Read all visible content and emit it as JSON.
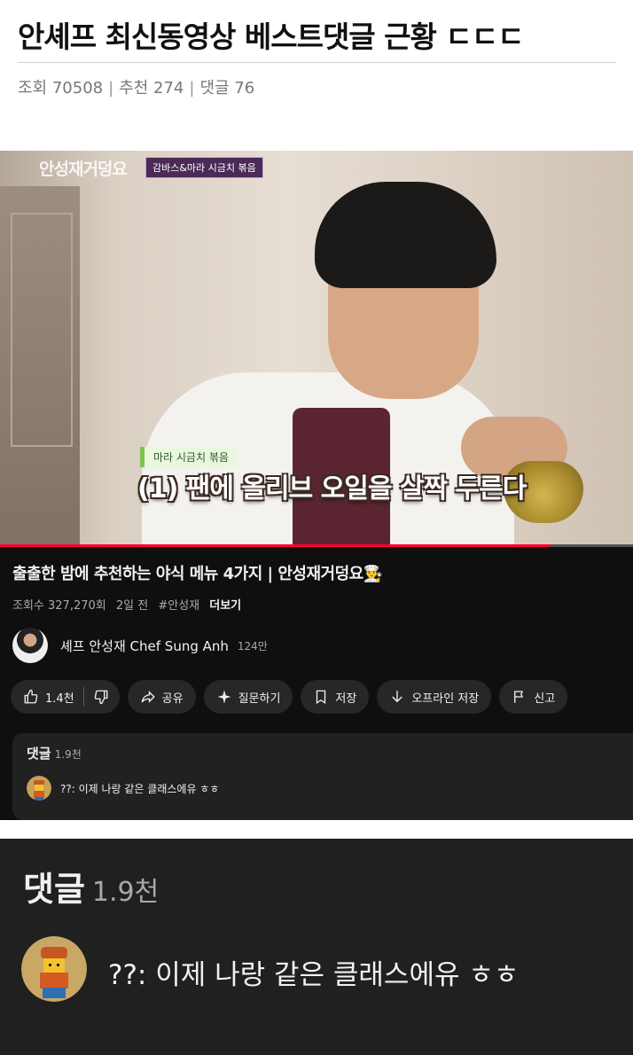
{
  "post": {
    "title": "안셰프 최신동영상 베스트댓글 근황 ㄷㄷㄷ",
    "views_label": "조회 70508",
    "recommend_label": "추천 274",
    "comments_label": "댓글 76",
    "separator": "|"
  },
  "video": {
    "channel_logo": "안성재거덩요",
    "episode_tag": "감바스&마라 시금치 볶음",
    "sub_label": "마라 시금치 볶음",
    "subtitle": "(1) 팬에 올리브 오일을 살짝 두른다",
    "progress": 0.87,
    "title": "출출한 밤에 추천하는 야식 메뉴 4가지 | 안성재거덩요👨‍🍳",
    "views": "조회수 327,270회",
    "date": "2일 전",
    "hashtag": "#안성재",
    "more": "더보기"
  },
  "channel": {
    "name": "셰프 안성재 Chef Sung Anh",
    "subs": "124만"
  },
  "actions": {
    "like_count": "1.4천",
    "share": "공유",
    "ask": "질문하기",
    "save": "저장",
    "offline": "오프라인 저장",
    "report": "신고"
  },
  "comments": {
    "header": "댓글",
    "count": "1.9천",
    "top_comment": "??: 이제 나랑 같은 클래스에유 ㅎㅎ"
  },
  "icons": [
    "thumb-up-icon",
    "thumb-down-icon",
    "share-icon",
    "sparkle-icon",
    "bookmark-icon",
    "download-icon",
    "flag-icon"
  ],
  "colors": {
    "progress": "#ff0033",
    "dark_bg": "#0f0f0f",
    "chip_bg": "#272727",
    "comment_bg": "#212121"
  }
}
